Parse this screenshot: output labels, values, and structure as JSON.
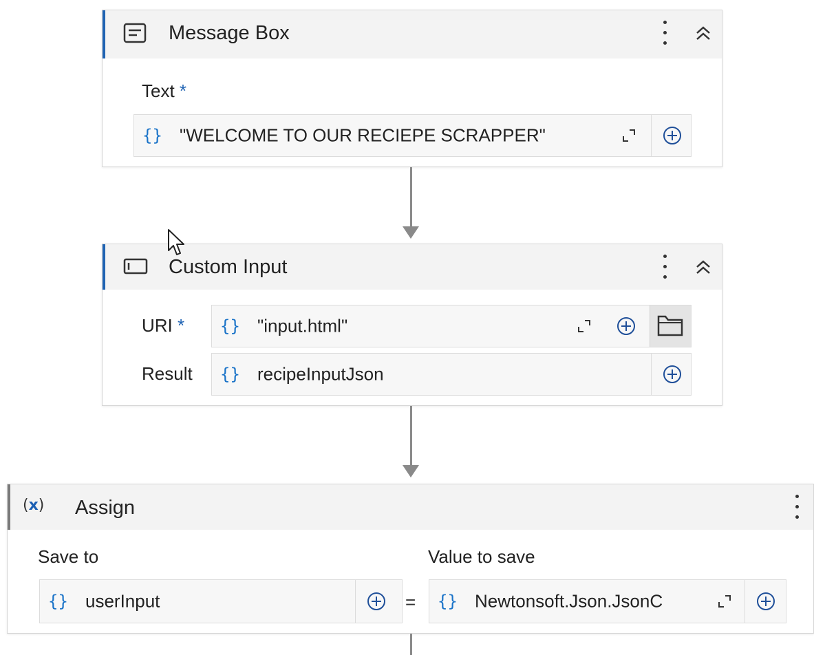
{
  "message_box": {
    "title": "Message Box",
    "text_label": "Text",
    "required_mark": "*",
    "text_value": "\"WELCOME TO OUR RECIEPE SCRAPPER\""
  },
  "custom_input": {
    "title": "Custom Input",
    "uri_label": "URI",
    "required_mark": "*",
    "uri_value": "\"input.html\"",
    "result_label": "Result",
    "result_value": "recipeInputJson"
  },
  "assign": {
    "title": "Assign",
    "save_to_label": "Save to",
    "value_to_save_label": "Value to save",
    "save_to_value": "userInput",
    "equals": "=",
    "value_value": "Newtonsoft.Json.JsonC"
  },
  "glyphs": {
    "brace": "{}",
    "var_icon": "(x)"
  },
  "colors": {
    "accent": "#1f63b3",
    "brace": "#1a73c8",
    "connector": "#8a8a8a"
  },
  "icons": [
    "message-box-icon",
    "input-box-icon",
    "variable-icon",
    "kebab-menu-icon",
    "collapse-icon",
    "expand-icon",
    "add-icon",
    "folder-icon"
  ]
}
